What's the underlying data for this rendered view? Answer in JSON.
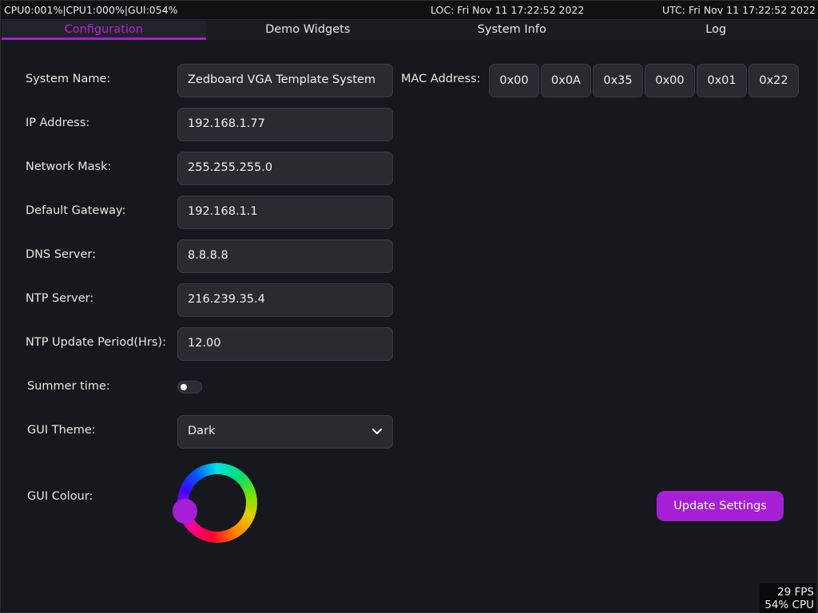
{
  "status": {
    "left": "CPU0:001%|CPU1:000%|GUI:054%",
    "local_time": "LOC: Fri Nov 11 17:22:52 2022",
    "utc_time": "UTC: Fri Nov 11 17:22:52 2022"
  },
  "tabs": [
    {
      "label": "Configuration",
      "active": true
    },
    {
      "label": "Demo Widgets",
      "active": false
    },
    {
      "label": "System Info",
      "active": false
    },
    {
      "label": "Log",
      "active": false
    }
  ],
  "form": {
    "system_name": {
      "label": "System Name:",
      "value": "Zedboard VGA Template System"
    },
    "mac_address": {
      "label": "MAC Address:",
      "octets": [
        "0x00",
        "0x0A",
        "0x35",
        "0x00",
        "0x01",
        "0x22"
      ]
    },
    "ip_address": {
      "label": "IP Address:",
      "value": "192.168.1.77"
    },
    "network_mask": {
      "label": "Network Mask:",
      "value": "255.255.255.0"
    },
    "default_gateway": {
      "label": "Default Gateway:",
      "value": "192.168.1.1"
    },
    "dns_server": {
      "label": "DNS Server:",
      "value": "8.8.8.8"
    },
    "ntp_server": {
      "label": "NTP Server:",
      "value": "216.239.35.4"
    },
    "ntp_update_period": {
      "label": "NTP Update Period(Hrs):",
      "value": "12.00"
    },
    "summer_time": {
      "label": "Summer time:",
      "enabled": false
    },
    "gui_theme": {
      "label": "GUI Theme:",
      "value": "Dark"
    },
    "gui_colour": {
      "label": "GUI Colour:",
      "value": "#a61fd6"
    }
  },
  "actions": {
    "update_label": "Update Settings"
  },
  "perf": {
    "fps": "29 FPS",
    "cpu": "54% CPU"
  },
  "colors": {
    "accent": "#a61fd6",
    "background": "#17181d",
    "field": "#2a2b31"
  }
}
